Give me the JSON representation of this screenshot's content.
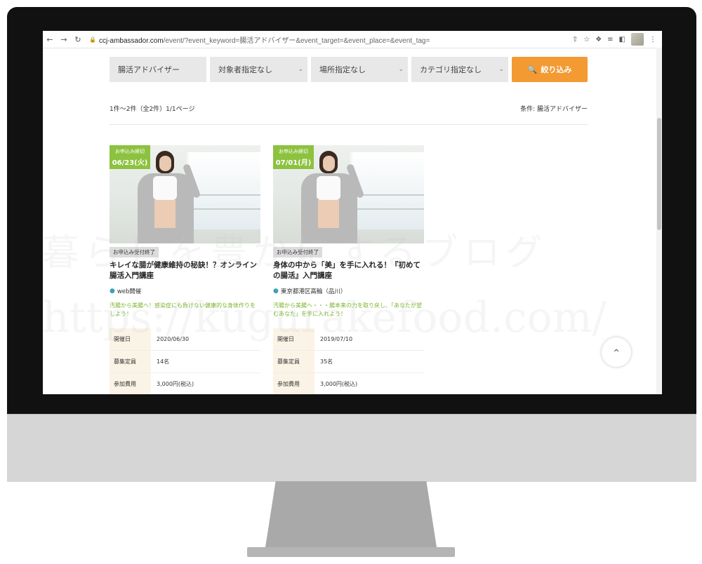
{
  "browser": {
    "nav": {
      "back": "←",
      "forward": "→",
      "reload": "↻"
    },
    "url_host": "ccj-ambassador.com",
    "url_rest": "/event/?event_keyword=腸活アドバイザー&event_target=&event_place=&event_tag=",
    "icons": [
      "share-icon",
      "star-icon",
      "extensions-icon",
      "reading-list-icon",
      "side-panel-icon",
      "profile-avatar",
      "menu-icon"
    ]
  },
  "filters": {
    "keyword_value": "腸活アドバイザー",
    "target_select": "対象者指定なし",
    "place_select": "場所指定なし",
    "category_select": "カテゴリ指定なし",
    "search_label": "絞り込み"
  },
  "results": {
    "count_text": "1件～2件（全2件）1/1ページ",
    "condition_text": "条件: 腸活アドバイザー"
  },
  "cards": [
    {
      "deadline_label": "お申込み締切",
      "deadline_date": "06/23(火)",
      "status": "お申込み受付終了",
      "title": "キレイな腸が健康維持の秘訣！？オンライン腸活入門講座",
      "place": "web開催",
      "description": "汚腸から美腸へ！感染症にも負けない健康的な身体作りをしよう！",
      "details": [
        {
          "key": "開催日",
          "value": "2020/06/30"
        },
        {
          "key": "募集定員",
          "value": "14名"
        },
        {
          "key": "参加費用",
          "value": "3,000円(税込)"
        }
      ]
    },
    {
      "deadline_label": "お申込み締切",
      "deadline_date": "07/01(月)",
      "status": "お申込み受付終了",
      "title": "身体の中から「美」を手に入れる！『初めての腸活』入門講座",
      "place": "東京都港区高輪（品川）",
      "description": "汚腸から美腸へ・・・腸本来の力を取り戻し、「あなたが望むあなた」を手に入れよう！",
      "details": [
        {
          "key": "開催日",
          "value": "2019/07/10"
        },
        {
          "key": "募集定員",
          "value": "35名"
        },
        {
          "key": "参加費用",
          "value": "3,000円(税込)"
        }
      ]
    }
  ],
  "watermark": {
    "line1": "暮らしを豊かにするブログ",
    "line2": "https://kugurakefood.com/"
  },
  "to_top_label": "^"
}
